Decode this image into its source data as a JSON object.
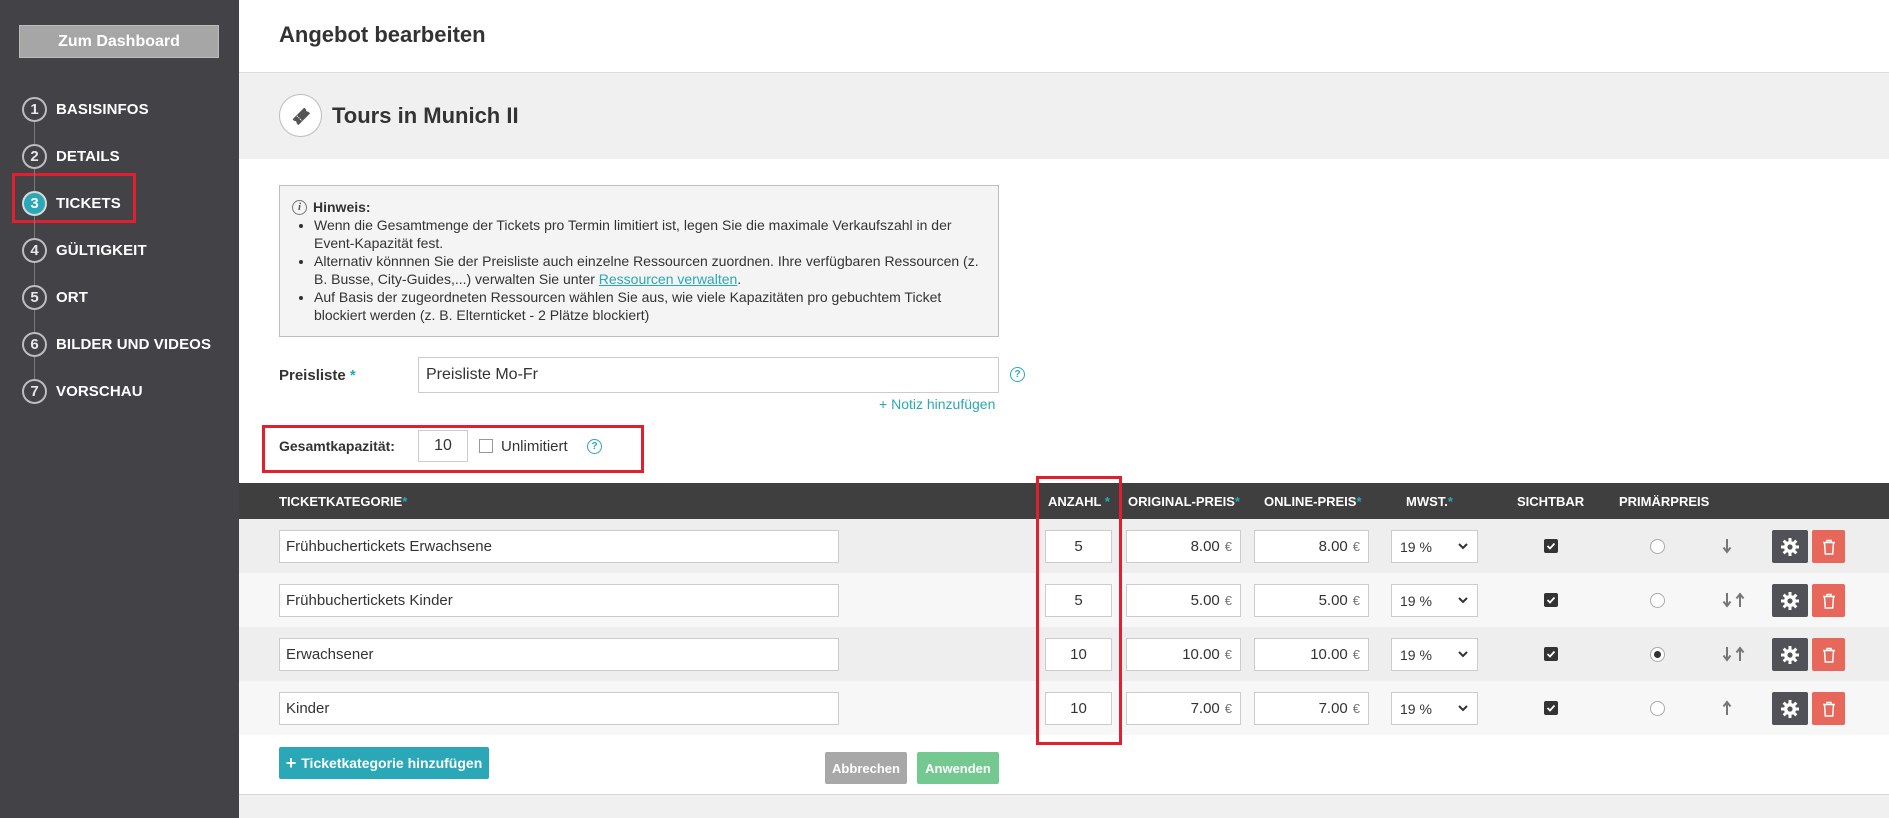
{
  "sidebar": {
    "dashboard_label": "Zum Dashboard",
    "steps": [
      {
        "num": "1",
        "label": "BASISINFOS"
      },
      {
        "num": "2",
        "label": "DETAILS"
      },
      {
        "num": "3",
        "label": "TICKETS"
      },
      {
        "num": "4",
        "label": "GÜLTIGKEIT"
      },
      {
        "num": "5",
        "label": "ORT"
      },
      {
        "num": "6",
        "label": "BILDER UND VIDEOS"
      },
      {
        "num": "7",
        "label": "VORSCHAU"
      }
    ],
    "active_step": 3
  },
  "header": {
    "title": "Angebot bearbeiten"
  },
  "offer": {
    "title": "Tours in Munich II",
    "icon": "ticket-icon"
  },
  "hint": {
    "title": "Hinweis:",
    "item1": "Wenn die Gesamtmenge der Tickets pro Termin limitiert ist, legen Sie die maximale Verkaufszahl in der Event-Kapazität fest.",
    "item2_prefix": "Alternativ könnnen Sie der Preisliste auch einzelne Ressourcen zuordnen. Ihre verfügbaren Ressourcen (z. B. Busse, City-Guides,...) verwalten Sie unter ",
    "item2_link": "Ressourcen verwalten",
    "item2_suffix": ".",
    "item3": "Auf Basis der zugeordneten Ressourcen wählen Sie aus, wie viele Kapazitäten pro gebuchtem Ticket blockiert werden (z. B. Elternticket - 2 Plätze blockiert)"
  },
  "pricelist": {
    "label": "Preisliste",
    "required_mark": "*",
    "value": "Preisliste Mo-Fr",
    "note_link": "Notiz hinzufügen",
    "note_plus": "+"
  },
  "capacity": {
    "label": "Gesamtkapazität:",
    "value": "10",
    "unlimited_label": "Unlimitiert",
    "unlimited_checked": false
  },
  "table": {
    "headers": {
      "category": "TICKETKATEGORIE",
      "count": "ANZAHL",
      "original_price": "ORIGINAL-PREIS",
      "online_price": "ONLINE-PREIS",
      "vat": "MWST.",
      "visible": "SICHTBAR",
      "primary": "PRIMÄRPREIS",
      "required_mark": "*"
    },
    "currency": "€",
    "rows": [
      {
        "category": "Frühbuchertickets Erwachsene",
        "count": "5",
        "original": "8.00",
        "online": "8.00",
        "vat": "19 %",
        "visible": true,
        "primary": false
      },
      {
        "category": "Frühbuchertickets Kinder",
        "count": "5",
        "original": "5.00",
        "online": "5.00",
        "vat": "19 %",
        "visible": true,
        "primary": false
      },
      {
        "category": "Erwachsener",
        "count": "10",
        "original": "10.00",
        "online": "10.00",
        "vat": "19 %",
        "visible": true,
        "primary": true
      },
      {
        "category": "Kinder",
        "count": "10",
        "original": "7.00",
        "online": "7.00",
        "vat": "19 %",
        "visible": true,
        "primary": false
      }
    ]
  },
  "actions": {
    "add_category": "Ticketkategorie hinzufügen",
    "add_plus": "+",
    "cancel": "Abbrechen",
    "apply": "Anwenden"
  },
  "colors": {
    "accent": "#2aa8b7",
    "sidebar_bg": "#424247",
    "highlight": "#e0202e",
    "delete": "#e8675b",
    "apply": "#73c98f"
  }
}
